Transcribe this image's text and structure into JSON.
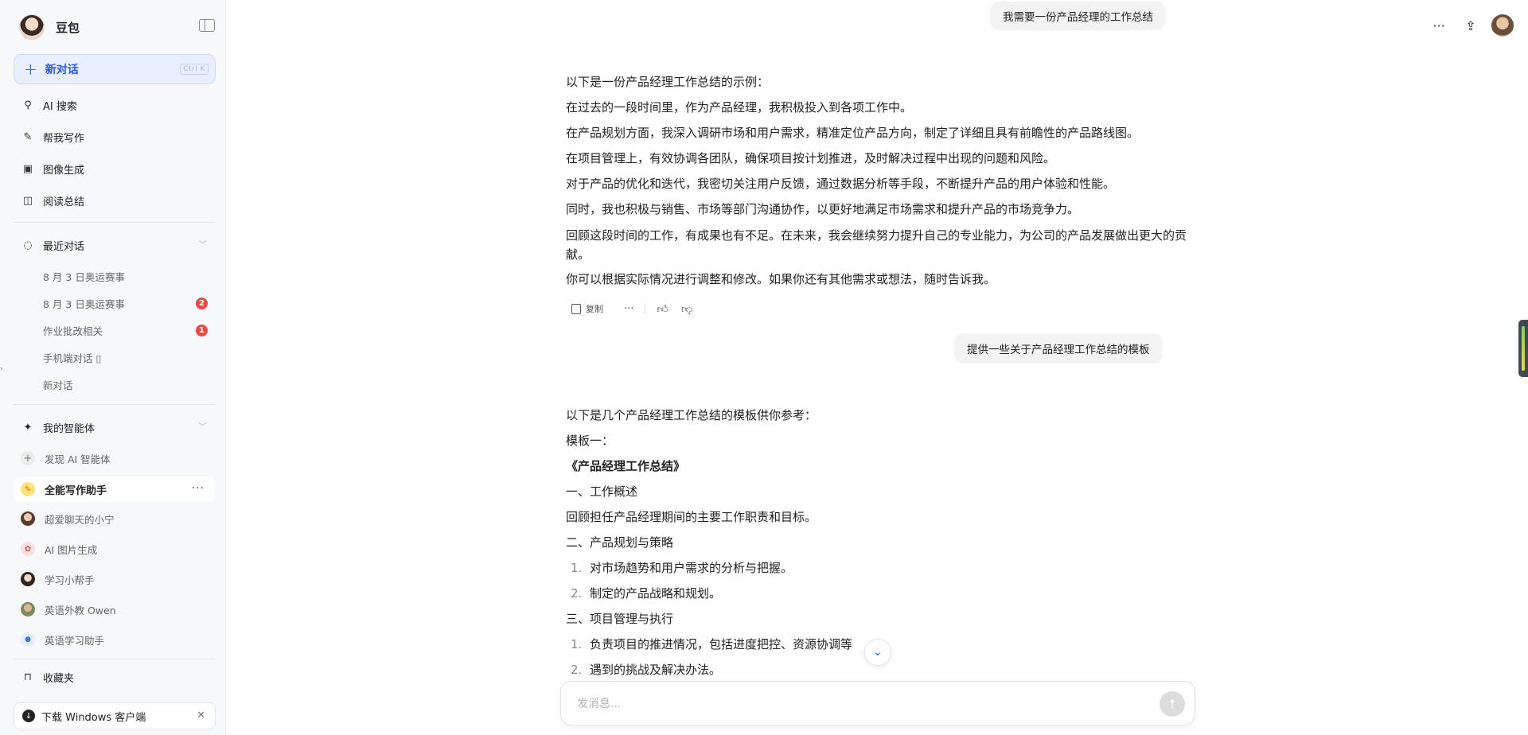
{
  "sidebar": {
    "brand_name": "豆包",
    "new_chat": {
      "label": "新对话",
      "shortcut": "Ctrl K"
    },
    "nav": [
      {
        "label": "AI 搜索",
        "icon": "search-icon"
      },
      {
        "label": "帮我写作",
        "icon": "pen-icon"
      },
      {
        "label": "图像生成",
        "icon": "image-icon"
      },
      {
        "label": "阅读总结",
        "icon": "book-icon"
      }
    ],
    "recent": {
      "title": "最近对话",
      "items": [
        {
          "label": "8 月 3 日奥运赛事",
          "badge": ""
        },
        {
          "label": "8 月 3 日奥运赛事",
          "badge": "2"
        },
        {
          "label": "作业批改相关",
          "badge": "1"
        },
        {
          "label": "手机端对话 ▯",
          "badge": ""
        },
        {
          "label": "新对话",
          "badge": ""
        }
      ]
    },
    "agents": {
      "title": "我的智能体",
      "discover": "发现 AI 智能体",
      "active": "全能写作助手",
      "items": [
        {
          "label": "超爱聊天的小宁"
        },
        {
          "label": "AI 图片生成"
        },
        {
          "label": "学习小帮手"
        },
        {
          "label": "英语外教 Owen"
        },
        {
          "label": "英语学习助手"
        }
      ]
    },
    "favorites": "收藏夹",
    "download": "下载 Windows 客户端"
  },
  "chat": {
    "user_msg_1": "我需要一份产品经理的工作总结",
    "reply_1": [
      "以下是一份产品经理工作总结的示例：",
      "在过去的一段时间里，作为产品经理，我积极投入到各项工作中。",
      "在产品规划方面，我深入调研市场和用户需求，精准定位产品方向，制定了详细且具有前瞻性的产品路线图。",
      "在项目管理上，有效协调各团队，确保项目按计划推进，及时解决过程中出现的问题和风险。",
      "对于产品的优化和迭代，我密切关注用户反馈，通过数据分析等手段，不断提升产品的用户体验和性能。",
      "同时，我也积极与销售、市场等部门沟通协作，以更好地满足市场需求和提升产品的市场竞争力。",
      "回顾这段时间的工作，有成果也有不足。在未来，我会继续努力提升自己的专业能力，为公司的产品发展做出更大的贡献。",
      "你可以根据实际情况进行调整和修改。如果你还有其他需求或想法，随时告诉我。"
    ],
    "copy_label": "复制",
    "user_msg_2": "提供一些关于产品经理工作总结的模板",
    "reply_2": {
      "intro": "以下是几个产品经理工作总结的模板供你参考：",
      "template_label": "模板一：",
      "title": "《产品经理工作总结》",
      "s1": "一、工作概述",
      "s1_body": "回顾担任产品经理期间的主要工作职责和目标。",
      "s2": "二、产品规划与策略",
      "s2_items": [
        "对市场趋势和用户需求的分析与把握。",
        "制定的产品战略和规划。"
      ],
      "s3": "三、项目管理与执行",
      "s3_items": [
        "负责项目的推进情况，包括进度把控、资源协调等",
        "遇到的挑战及解决办法。"
      ]
    },
    "composer_placeholder": "发消息..."
  }
}
